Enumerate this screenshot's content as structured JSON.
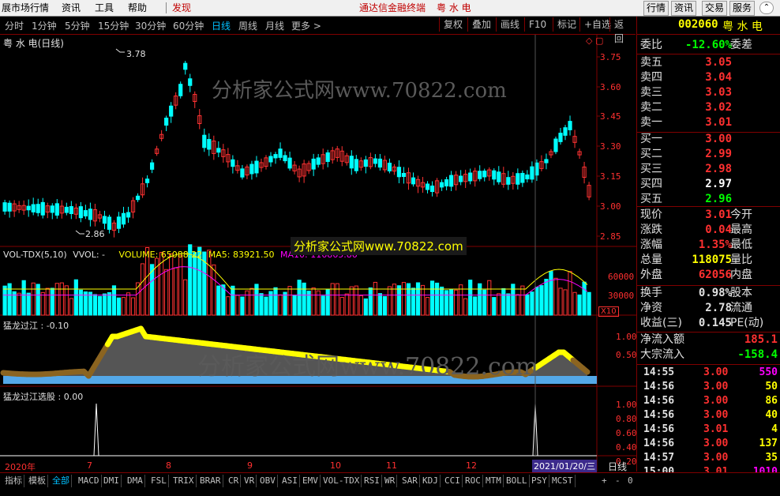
{
  "menubar": {
    "items": [
      "展市场行情",
      "资讯",
      "工具",
      "帮助"
    ],
    "alert": "发现",
    "center_title": "通达信金融终端",
    "center_stock": "粤 水 电",
    "right_buttons": [
      "行情",
      "资讯",
      "交易",
      "服务"
    ]
  },
  "toolbar": {
    "periods": [
      "分时",
      "1分钟",
      "5分钟",
      "15分钟",
      "30分钟",
      "60分钟",
      "日线",
      "周线",
      "月线",
      "更多 >"
    ],
    "active_period": "日线",
    "buttons": [
      "复权",
      "叠加",
      "画线",
      "F10",
      "标记",
      "+自选",
      "返回"
    ]
  },
  "chart": {
    "title": "粤 水 电(日线)",
    "high_label": "3.78",
    "low_label": "2.86",
    "price_axis": [
      "3.75",
      "3.60",
      "3.45",
      "3.30",
      "3.15",
      "3.00",
      "2.85"
    ],
    "vol_header": {
      "name": "VOL-TDX(5,10)",
      "vvol": "VVOL: -",
      "volume": "VOLUME: 65088.22",
      "ma5": "MA5: 83921.50",
      "ma10": "MA10: 116865.86"
    },
    "vol_axis": [
      "60000",
      "30000"
    ],
    "vol_unit": "X10",
    "ind1_header": "猛龙过江 : -0.10",
    "ind1_axis": [
      "1.00",
      "0.50"
    ],
    "ind2_header": "猛龙过江选股 : 0.00",
    "ind2_axis": [
      "1.00",
      "0.80",
      "0.60",
      "0.40",
      "0.20"
    ],
    "date_axis": [
      "2020年",
      "7",
      "8",
      "9",
      "10",
      "11",
      "12"
    ],
    "cursor_date": "2021/01/20/三",
    "period_label": "日线",
    "watermark1": "分析家公式网www.70822.com",
    "watermark2": "分析家公式网www.70822.com",
    "watermark3": "分析家公式网www.70822.com",
    "colors": {
      "up": "#ff3232",
      "down": "#00ffff",
      "ma5": "#ffffff",
      "ma10": "#ff00ff",
      "thick": "#ffff00",
      "brown": "#8b6420",
      "blue": "#54a8e8",
      "fill": "#6a6a6a"
    }
  },
  "quote": {
    "code": "002060",
    "name": "粤 水 电",
    "weibi": {
      "label": "委比",
      "value": "-12.60%",
      "label2": "委差"
    },
    "sells": [
      {
        "label": "卖五",
        "price": "3.05"
      },
      {
        "label": "卖四",
        "price": "3.04"
      },
      {
        "label": "卖三",
        "price": "3.03"
      },
      {
        "label": "卖二",
        "price": "3.02"
      },
      {
        "label": "卖一",
        "price": "3.01"
      }
    ],
    "buys": [
      {
        "label": "买一",
        "price": "3.00"
      },
      {
        "label": "买二",
        "price": "2.99"
      },
      {
        "label": "买三",
        "price": "2.98"
      },
      {
        "label": "买四",
        "price": "2.97"
      },
      {
        "label": "买五",
        "price": "2.96"
      }
    ],
    "stats": [
      {
        "label": "现价",
        "value": "3.01",
        "label2": "今开",
        "color": "#ff3030"
      },
      {
        "label": "涨跌",
        "value": "0.04",
        "label2": "最高",
        "color": "#ff3030"
      },
      {
        "label": "涨幅",
        "value": "1.35%",
        "label2": "最低",
        "color": "#ff3030"
      },
      {
        "label": "总量",
        "value": "118075",
        "label2": "量比",
        "color": "#ffff00"
      },
      {
        "label": "外盘",
        "value": "62056",
        "label2": "内盘",
        "color": "#ff3030"
      }
    ],
    "stats2": [
      {
        "label": "换手",
        "value": "0.98%",
        "label2": "股本"
      },
      {
        "label": "净资",
        "value": "2.78",
        "label2": "流通"
      },
      {
        "label": "收益(三)",
        "value": "0.145",
        "label2": "PE(动)"
      }
    ],
    "flow": [
      {
        "label": "净流入额",
        "value": "185.1",
        "color": "#ff3030"
      },
      {
        "label": "大宗流入",
        "value": "-158.4",
        "color": "#00ff00"
      }
    ],
    "ticks": [
      {
        "time": "14:55",
        "price": "3.00",
        "vol": "550",
        "color": "#ff00ff"
      },
      {
        "time": "14:56",
        "price": "3.00",
        "vol": "50",
        "color": "#ffff00"
      },
      {
        "time": "14:56",
        "price": "3.00",
        "vol": "86",
        "color": "#ffff00"
      },
      {
        "time": "14:56",
        "price": "3.00",
        "vol": "40",
        "color": "#ffff00"
      },
      {
        "time": "14:56",
        "price": "3.01",
        "vol": "4",
        "color": "#ffff00"
      },
      {
        "time": "14:56",
        "price": "3.00",
        "vol": "137",
        "color": "#ffff00"
      },
      {
        "time": "14:57",
        "price": "3.00",
        "vol": "35",
        "color": "#ffff00"
      },
      {
        "time": "15:00",
        "price": "3.01",
        "vol": "1010",
        "color": "#ff00ff"
      }
    ]
  },
  "tabs": {
    "left": [
      "指标",
      "模板",
      "全部"
    ],
    "indicators": [
      "MACD",
      "DMI",
      "DMA",
      "FSL",
      "TRIX",
      "BRAR",
      "CR",
      "VR",
      "OBV",
      "ASI",
      "EMV",
      "VOL-TDX",
      "RSI",
      "WR",
      "SAR",
      "KDJ",
      "CCI",
      "ROC",
      "MTM",
      "BOLL",
      "PSY",
      "MCST"
    ],
    "controls": [
      "+",
      "-",
      "0"
    ]
  }
}
